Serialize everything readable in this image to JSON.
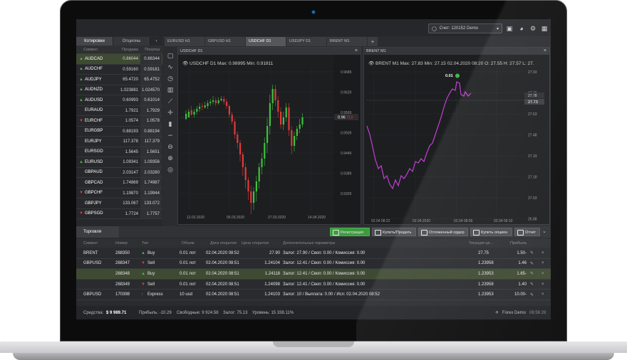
{
  "top": {
    "account_label": "Счет: 120152 Demo"
  },
  "quotes": {
    "tabs": [
      "Котировки",
      "Опционы"
    ],
    "columns": [
      "Символ",
      "Продажа",
      "Покупка"
    ],
    "rows": [
      {
        "symbol": "AUDCAD",
        "sell": "0.86044",
        "buy": "0.86344",
        "trend": "up",
        "selected": true
      },
      {
        "symbol": "AUDCHF",
        "sell": "0.59160",
        "buy": "0.59181",
        "trend": "up"
      },
      {
        "symbol": "AUDJPY",
        "sell": "65.4720",
        "buy": "65.4752",
        "trend": "up"
      },
      {
        "symbol": "AUDNZD",
        "sell": "1.023881",
        "buy": "1.024570",
        "trend": "up"
      },
      {
        "symbol": "AUDUSD",
        "sell": "0.60993",
        "buy": "0.61014",
        "trend": "up"
      },
      {
        "symbol": "EURAUD",
        "sell": "1.7921",
        "buy": "1.7929",
        "trend": "none"
      },
      {
        "symbol": "EURCHF",
        "sell": "1.0574",
        "buy": "1.0578",
        "trend": "down"
      },
      {
        "symbol": "EURGBP",
        "sell": "0.88193",
        "buy": "0.88194",
        "trend": "none"
      },
      {
        "symbol": "EURJPY",
        "sell": "117.378",
        "buy": "117.379",
        "trend": "none"
      },
      {
        "symbol": "EURSGD",
        "sell": "1.5645",
        "buy": "1.5651",
        "trend": "none"
      },
      {
        "symbol": "EURUSD",
        "sell": "1.09341",
        "buy": "1.09356",
        "trend": "up"
      },
      {
        "symbol": "GBPAUD",
        "sell": "2.03147",
        "buy": "2.03280",
        "trend": "none"
      },
      {
        "symbol": "GBPCAD",
        "sell": "1.74869",
        "buy": "1.74987",
        "trend": "none"
      },
      {
        "symbol": "GBPCHF",
        "sell": "1.19870",
        "buy": "1.19944",
        "trend": "down"
      },
      {
        "symbol": "GBPJPY",
        "sell": "133.067",
        "buy": "133.072",
        "trend": "none"
      },
      {
        "symbol": "GBPSGD",
        "sell": "1.7724",
        "buy": "1.7757",
        "trend": "down"
      }
    ]
  },
  "chart_tabs": [
    {
      "label": "EURUSD H1",
      "active": false
    },
    {
      "label": "GBPUSD H1",
      "active": false
    },
    {
      "label": "USDCHF D1",
      "active": true
    },
    {
      "label": "USDJPY D1",
      "active": false
    },
    {
      "label": "BRENT M1",
      "active": false
    },
    {
      "label": "+",
      "active": false
    }
  ],
  "chart1": {
    "window_title": "USDCHF D1",
    "info": {
      "symbol": "USDCHF",
      "tf": "D1",
      "max": "Max: 0.98995",
      "min": "Min: 0.91811"
    },
    "y_ticks": [
      "0.9689",
      "0.9629",
      "0.9569",
      "0.9509",
      "0.9449",
      "0.9389",
      "0.9329"
    ],
    "x_ticks": [
      "12.02.2020",
      "05.03.2020",
      "27.03.2020",
      "14.04.2020"
    ],
    "current": {
      "label": "0.96",
      "highlight": "713"
    }
  },
  "chart2": {
    "window_title": "BRENT M1",
    "info": {
      "symbol": "BRENT",
      "tf": "M1",
      "max": "Max: 27.83",
      "min": "Min: 27.15",
      "time": "02.04.2020 08:20",
      "o": "O: 27.55",
      "h": "H: 27.57",
      "l": "L: 27."
    },
    "y_ticks": [
      "27.93",
      "27.78",
      "27.63",
      "27.48",
      "27.33",
      "27.18",
      "27.03",
      "26.88"
    ],
    "x_ticks": [
      "02.04 08:22",
      "02.04.2020",
      "02.04 08:56",
      "02.04 09:10"
    ],
    "current": {
      "tag": "27.78",
      "value": "27.73"
    },
    "marker": "0.01"
  },
  "bottom": {
    "tab": "Торговля",
    "buttons": [
      "Регистрация",
      "Купить/Продать",
      "Отложенный ордер",
      "Купить опцион",
      "Отчет"
    ],
    "columns": [
      "Символ",
      "Номер",
      "Тип",
      "Объем",
      "Дата открытия",
      "Цена открытия",
      "Дополнительные параметры",
      "Текущая це...",
      "Прибыль"
    ],
    "rows": [
      {
        "symbol": "BRENT",
        "num": "288350",
        "type": "Buy",
        "dir": "up",
        "vol": "0.01 лот",
        "date": "02.04.2020 08:52",
        "price": "27.90",
        "params": "Залог: 27.90 / Своп: 0.00 / Комиссия: 0.00",
        "current": "27.75",
        "profit": "-1.50"
      },
      {
        "symbol": "GBPUSD",
        "num": "288347",
        "type": "Sell",
        "dir": "down",
        "vol": "0.01 лот",
        "date": "02.04.2020 08:51",
        "price": "1.24104",
        "params": "Залог: 12.41 / Своп: 0.00 / Комиссия: 0.00",
        "current": "1.23958",
        "profit": "1.46",
        "selected": false
      },
      {
        "symbol": "",
        "num": "288348",
        "type": "Buy",
        "dir": "up",
        "vol": "0.01 лот",
        "date": "02.04.2020 08:51",
        "price": "1.24118",
        "params": "Залог: 12.41 / Своп: 0.00 / Комиссия: 0.00",
        "current": "1.23953",
        "profit": "-1.65",
        "selected": true
      },
      {
        "symbol": "",
        "num": "288349",
        "type": "Sell",
        "dir": "down",
        "vol": "0.01 лот",
        "date": "02.04.2020 08:51",
        "price": "1.24098",
        "params": "Залог: 12.41 / Своп: 0.00 / Комиссия: 0.00",
        "current": "1.23958",
        "profit": "1.40"
      },
      {
        "symbol": "GBPUSD",
        "num": "170398",
        "type": "Express",
        "dir": "express",
        "vol": "10 usd",
        "date": "02.04.2020 08:51",
        "price": "1.24103",
        "params": "Залог: 10 / Выплата: 0.00 / Исп: 02.04.2020 08:52",
        "current": "1.23953",
        "profit": "-10.00"
      }
    ]
  },
  "status": {
    "funds_label": "Средства:",
    "funds_value": "$ 9 989.71",
    "profit": "Прибыль: -10.29",
    "free": "Свободные: 9 924.58",
    "margin": "Залог: 75.13",
    "level": "Уровень: 15 338.11%",
    "server": "Forex Demo",
    "time": "08:56:28"
  },
  "colors": {
    "up": "#45b649",
    "down": "#e53935",
    "accent": "#3e9a3f",
    "brent_line": "#c23fd6"
  }
}
